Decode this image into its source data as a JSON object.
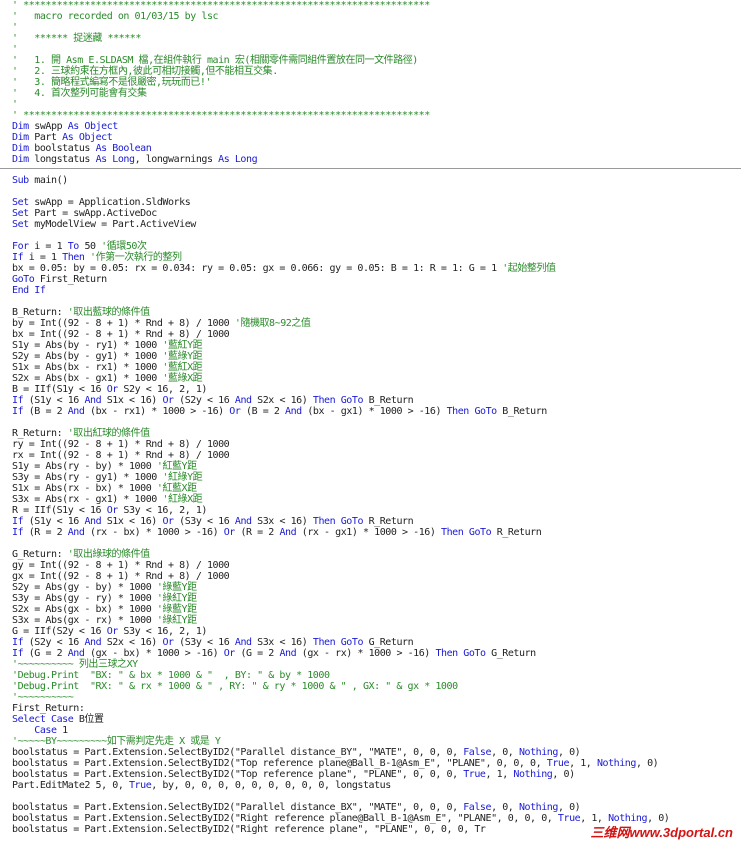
{
  "colors": {
    "keyword": "#1a1ad6",
    "comment": "#2a8a2a",
    "text": "#222222",
    "watermark": "#d31212"
  },
  "top_pane": {
    "lines": [
      [
        [
          "cm",
          "' *************************************************************************"
        ]
      ],
      [
        [
          "cm",
          "'   macro recorded on 01/03/15 by lsc"
        ]
      ],
      [
        [
          "cm",
          "'"
        ]
      ],
      [
        [
          "cm",
          "'   ****** 捉迷藏 ******"
        ]
      ],
      [
        [
          "cm",
          "'"
        ]
      ],
      [
        [
          "cm",
          "'   1. 開 Asm_E.SLDASM 檔,在組件執行 main 宏(相關零件需同組件置放在同一文件路徑)"
        ]
      ],
      [
        [
          "cm",
          "'   2. 三球約束在方框內,彼此可相切接觸,但不能相互交集."
        ]
      ],
      [
        [
          "cm",
          "'   3. 簡略程式編寫不是很嚴密,玩玩而已!'"
        ]
      ],
      [
        [
          "cm",
          "'   4. 首次整列可能會有交集"
        ]
      ],
      [
        [
          "cm",
          "'"
        ]
      ],
      [
        [
          "cm",
          "' *************************************************************************"
        ]
      ],
      [
        [
          "kw",
          "Dim"
        ],
        [
          "tx",
          " swApp "
        ],
        [
          "kw",
          "As Object"
        ]
      ],
      [
        [
          "kw",
          "Dim"
        ],
        [
          "tx",
          " Part "
        ],
        [
          "kw",
          "As Object"
        ]
      ],
      [
        [
          "kw",
          "Dim"
        ],
        [
          "tx",
          " boolstatus "
        ],
        [
          "kw",
          "As Boolean"
        ]
      ],
      [
        [
          "kw",
          "Dim"
        ],
        [
          "tx",
          " longstatus "
        ],
        [
          "kw",
          "As Long"
        ],
        [
          "tx",
          ", longwarnings "
        ],
        [
          "kw",
          "As Long"
        ]
      ]
    ]
  },
  "bottom_pane": {
    "lines": [
      [
        [
          "kw",
          "Sub"
        ],
        [
          "tx",
          " main()"
        ]
      ],
      [
        [
          "tx",
          ""
        ]
      ],
      [
        [
          "kw",
          "Set"
        ],
        [
          "tx",
          " swApp = Application.SldWorks"
        ]
      ],
      [
        [
          "kw",
          "Set"
        ],
        [
          "tx",
          " Part = swApp.ActiveDoc"
        ]
      ],
      [
        [
          "kw",
          "Set"
        ],
        [
          "tx",
          " myModelView = Part.ActiveView"
        ]
      ],
      [
        [
          "tx",
          ""
        ]
      ],
      [
        [
          "kw",
          "For"
        ],
        [
          "tx",
          " i = 1 "
        ],
        [
          "kw",
          "To"
        ],
        [
          "tx",
          " 50 "
        ],
        [
          "cm",
          "'循環50次"
        ]
      ],
      [
        [
          "kw",
          "If"
        ],
        [
          "tx",
          " i = 1 "
        ],
        [
          "kw",
          "Then"
        ],
        [
          "tx",
          " "
        ],
        [
          "cm",
          "'作第一次執行的整列"
        ]
      ],
      [
        [
          "tx",
          "bx = 0.05: by = 0.05: rx = 0.034: ry = 0.05: gx = 0.066: gy = 0.05: B = 1: R = 1: G = 1 "
        ],
        [
          "cm",
          "'起始整列值"
        ]
      ],
      [
        [
          "kw",
          "GoTo"
        ],
        [
          "tx",
          " First_Return"
        ]
      ],
      [
        [
          "kw",
          "End If"
        ]
      ],
      [
        [
          "tx",
          ""
        ]
      ],
      [
        [
          "tx",
          "B_Return: "
        ],
        [
          "cm",
          "'取出藍球的條件值"
        ]
      ],
      [
        [
          "tx",
          "by = Int((92 - 8 + 1) * Rnd + 8) / 1000 "
        ],
        [
          "cm",
          "'隨機取8~92之值"
        ]
      ],
      [
        [
          "tx",
          "bx = Int((92 - 8 + 1) * Rnd + 8) / 1000"
        ]
      ],
      [
        [
          "tx",
          "S1y = Abs(by - ry1) * 1000 "
        ],
        [
          "cm",
          "'藍紅Y距"
        ]
      ],
      [
        [
          "tx",
          "S2y = Abs(by - gy1) * 1000 "
        ],
        [
          "cm",
          "'藍綠Y距"
        ]
      ],
      [
        [
          "tx",
          "S1x = Abs(bx - rx1) * 1000 "
        ],
        [
          "cm",
          "'藍紅X距"
        ]
      ],
      [
        [
          "tx",
          "S2x = Abs(bx - gx1) * 1000 "
        ],
        [
          "cm",
          "'藍綠X距"
        ]
      ],
      [
        [
          "tx",
          "B = IIf(S1y < 16 "
        ],
        [
          "kw",
          "Or"
        ],
        [
          "tx",
          " S2y < 16, 2, 1)"
        ]
      ],
      [
        [
          "kw",
          "If"
        ],
        [
          "tx",
          " (S1y < 16 "
        ],
        [
          "kw",
          "And"
        ],
        [
          "tx",
          " S1x < 16) "
        ],
        [
          "kw",
          "Or"
        ],
        [
          "tx",
          " (S2y < 16 "
        ],
        [
          "kw",
          "And"
        ],
        [
          "tx",
          " S2x < 16) "
        ],
        [
          "kw",
          "Then GoTo"
        ],
        [
          "tx",
          " B_Return"
        ]
      ],
      [
        [
          "kw",
          "If"
        ],
        [
          "tx",
          " (B = 2 "
        ],
        [
          "kw",
          "And"
        ],
        [
          "tx",
          " (bx - rx1) * 1000 > -16) "
        ],
        [
          "kw",
          "Or"
        ],
        [
          "tx",
          " (B = 2 "
        ],
        [
          "kw",
          "And"
        ],
        [
          "tx",
          " (bx - gx1) * 1000 > -16) "
        ],
        [
          "kw",
          "Then GoTo"
        ],
        [
          "tx",
          " B_Return"
        ]
      ],
      [
        [
          "tx",
          ""
        ]
      ],
      [
        [
          "tx",
          "R_Return: "
        ],
        [
          "cm",
          "'取出紅球的條件值"
        ]
      ],
      [
        [
          "tx",
          "ry = Int((92 - 8 + 1) * Rnd + 8) / 1000"
        ]
      ],
      [
        [
          "tx",
          "rx = Int((92 - 8 + 1) * Rnd + 8) / 1000"
        ]
      ],
      [
        [
          "tx",
          "S1y = Abs(ry - by) * 1000 "
        ],
        [
          "cm",
          "'紅藍Y距"
        ]
      ],
      [
        [
          "tx",
          "S3y = Abs(ry - gy1) * 1000 "
        ],
        [
          "cm",
          "'紅綠Y距"
        ]
      ],
      [
        [
          "tx",
          "S1x = Abs(rx - bx) * 1000 "
        ],
        [
          "cm",
          "'紅藍X距"
        ]
      ],
      [
        [
          "tx",
          "S3x = Abs(rx - gx1) * 1000 "
        ],
        [
          "cm",
          "'紅綠X距"
        ]
      ],
      [
        [
          "tx",
          "R = IIf(S1y < 16 "
        ],
        [
          "kw",
          "Or"
        ],
        [
          "tx",
          " S3y < 16, 2, 1)"
        ]
      ],
      [
        [
          "kw",
          "If"
        ],
        [
          "tx",
          " (S1y < 16 "
        ],
        [
          "kw",
          "And"
        ],
        [
          "tx",
          " S1x < 16) "
        ],
        [
          "kw",
          "Or"
        ],
        [
          "tx",
          " (S3y < 16 "
        ],
        [
          "kw",
          "And"
        ],
        [
          "tx",
          " S3x < 16) "
        ],
        [
          "kw",
          "Then GoTo"
        ],
        [
          "tx",
          " R_Return"
        ]
      ],
      [
        [
          "kw",
          "If"
        ],
        [
          "tx",
          " (R = 2 "
        ],
        [
          "kw",
          "And"
        ],
        [
          "tx",
          " (rx - bx) * 1000 > -16) "
        ],
        [
          "kw",
          "Or"
        ],
        [
          "tx",
          " (R = 2 "
        ],
        [
          "kw",
          "And"
        ],
        [
          "tx",
          " (rx - gx1) * 1000 > -16) "
        ],
        [
          "kw",
          "Then GoTo"
        ],
        [
          "tx",
          " R_Return"
        ]
      ],
      [
        [
          "tx",
          ""
        ]
      ],
      [
        [
          "tx",
          "G_Return: "
        ],
        [
          "cm",
          "'取出綠球的條件值"
        ]
      ],
      [
        [
          "tx",
          "gy = Int((92 - 8 + 1) * Rnd + 8) / 1000"
        ]
      ],
      [
        [
          "tx",
          "gx = Int((92 - 8 + 1) * Rnd + 8) / 1000"
        ]
      ],
      [
        [
          "tx",
          "S2y = Abs(gy - by) * 1000 "
        ],
        [
          "cm",
          "'綠藍Y距"
        ]
      ],
      [
        [
          "tx",
          "S3y = Abs(gy - ry) * 1000 "
        ],
        [
          "cm",
          "'綠紅Y距"
        ]
      ],
      [
        [
          "tx",
          "S2x = Abs(gx - bx) * 1000 "
        ],
        [
          "cm",
          "'綠藍Y距"
        ]
      ],
      [
        [
          "tx",
          "S3x = Abs(gx - rx) * 1000 "
        ],
        [
          "cm",
          "'綠紅Y距"
        ]
      ],
      [
        [
          "tx",
          "G = IIf(S2y < 16 "
        ],
        [
          "kw",
          "Or"
        ],
        [
          "tx",
          " S3y < 16, 2, 1)"
        ]
      ],
      [
        [
          "kw",
          "If"
        ],
        [
          "tx",
          " (S2y < 16 "
        ],
        [
          "kw",
          "And"
        ],
        [
          "tx",
          " S2x < 16) "
        ],
        [
          "kw",
          "Or"
        ],
        [
          "tx",
          " (S3y < 16 "
        ],
        [
          "kw",
          "And"
        ],
        [
          "tx",
          " S3x < 16) "
        ],
        [
          "kw",
          "Then GoTo"
        ],
        [
          "tx",
          " G_Return"
        ]
      ],
      [
        [
          "kw",
          "If"
        ],
        [
          "tx",
          " (G = 2 "
        ],
        [
          "kw",
          "And"
        ],
        [
          "tx",
          " (gx - bx) * 1000 > -16) "
        ],
        [
          "kw",
          "Or"
        ],
        [
          "tx",
          " (G = 2 "
        ],
        [
          "kw",
          "And"
        ],
        [
          "tx",
          " (gx - rx) * 1000 > -16) "
        ],
        [
          "kw",
          "Then GoTo"
        ],
        [
          "tx",
          " G_Return"
        ]
      ],
      [
        [
          "cm",
          "'~~~~~~~~~~ 列出三球之XY"
        ]
      ],
      [
        [
          "cm",
          "'Debug.Print  \"BX: \" & bx * 1000 & \"  , BY: \" & by * 1000"
        ]
      ],
      [
        [
          "cm",
          "'Debug.Print  \"RX: \" & rx * 1000 & \" , RY: \" & ry * 1000 & \" , GX: \" & gx * 1000"
        ]
      ],
      [
        [
          "cm",
          "'~~~~~~~~~~"
        ]
      ],
      [
        [
          "tx",
          "First_Return:"
        ]
      ],
      [
        [
          "kw",
          "Select Case"
        ],
        [
          "tx",
          " B位置"
        ]
      ],
      [
        [
          "kw",
          "    Case"
        ],
        [
          "tx",
          " 1"
        ]
      ],
      [
        [
          "cm",
          "'~~~~~BY~~~~~~~~~如下需判定先走 X 或是 Y"
        ]
      ],
      [
        [
          "tx",
          "boolstatus = Part.Extension.SelectByID2(\"Parallel distance_BY\", \"MATE\", 0, 0, 0, "
        ],
        [
          "kw",
          "False"
        ],
        [
          "tx",
          ", 0, "
        ],
        [
          "kw",
          "Nothing"
        ],
        [
          "tx",
          ", 0)"
        ]
      ],
      [
        [
          "tx",
          "boolstatus = Part.Extension.SelectByID2(\"Top reference plane@Ball_B-1@Asm_E\", \"PLANE\", 0, 0, 0, "
        ],
        [
          "kw",
          "True"
        ],
        [
          "tx",
          ", 1, "
        ],
        [
          "kw",
          "Nothing"
        ],
        [
          "tx",
          ", 0)"
        ]
      ],
      [
        [
          "tx",
          "boolstatus = Part.Extension.SelectByID2(\"Top reference plane\", \"PLANE\", 0, 0, 0, "
        ],
        [
          "kw",
          "True"
        ],
        [
          "tx",
          ", 1, "
        ],
        [
          "kw",
          "Nothing"
        ],
        [
          "tx",
          ", 0)"
        ]
      ],
      [
        [
          "tx",
          "Part.EditMate2 5, 0, "
        ],
        [
          "kw",
          "True"
        ],
        [
          "tx",
          ", by, 0, 0, 0, 0, 0, 0, 0, 0, 0, longstatus"
        ]
      ],
      [
        [
          "tx",
          ""
        ]
      ],
      [
        [
          "tx",
          "boolstatus = Part.Extension.SelectByID2(\"Parallel distance_BX\", \"MATE\", 0, 0, 0, "
        ],
        [
          "kw",
          "False"
        ],
        [
          "tx",
          ", 0, "
        ],
        [
          "kw",
          "Nothing"
        ],
        [
          "tx",
          ", 0)"
        ]
      ],
      [
        [
          "tx",
          "boolstatus = Part.Extension.SelectByID2(\"Right reference plane@Ball_B-1@Asm_E\", \"PLANE\", 0, 0, 0, "
        ],
        [
          "kw",
          "True"
        ],
        [
          "tx",
          ", 1, "
        ],
        [
          "kw",
          "Nothing"
        ],
        [
          "tx",
          ", 0)"
        ]
      ],
      [
        [
          "tx",
          "boolstatus = Part.Extension.SelectByID2(\"Right reference plane\", \"PLANE\", 0, 0, 0, Tr"
        ]
      ]
    ]
  },
  "watermark": {
    "text": "三维网www.3dportal.cn"
  }
}
